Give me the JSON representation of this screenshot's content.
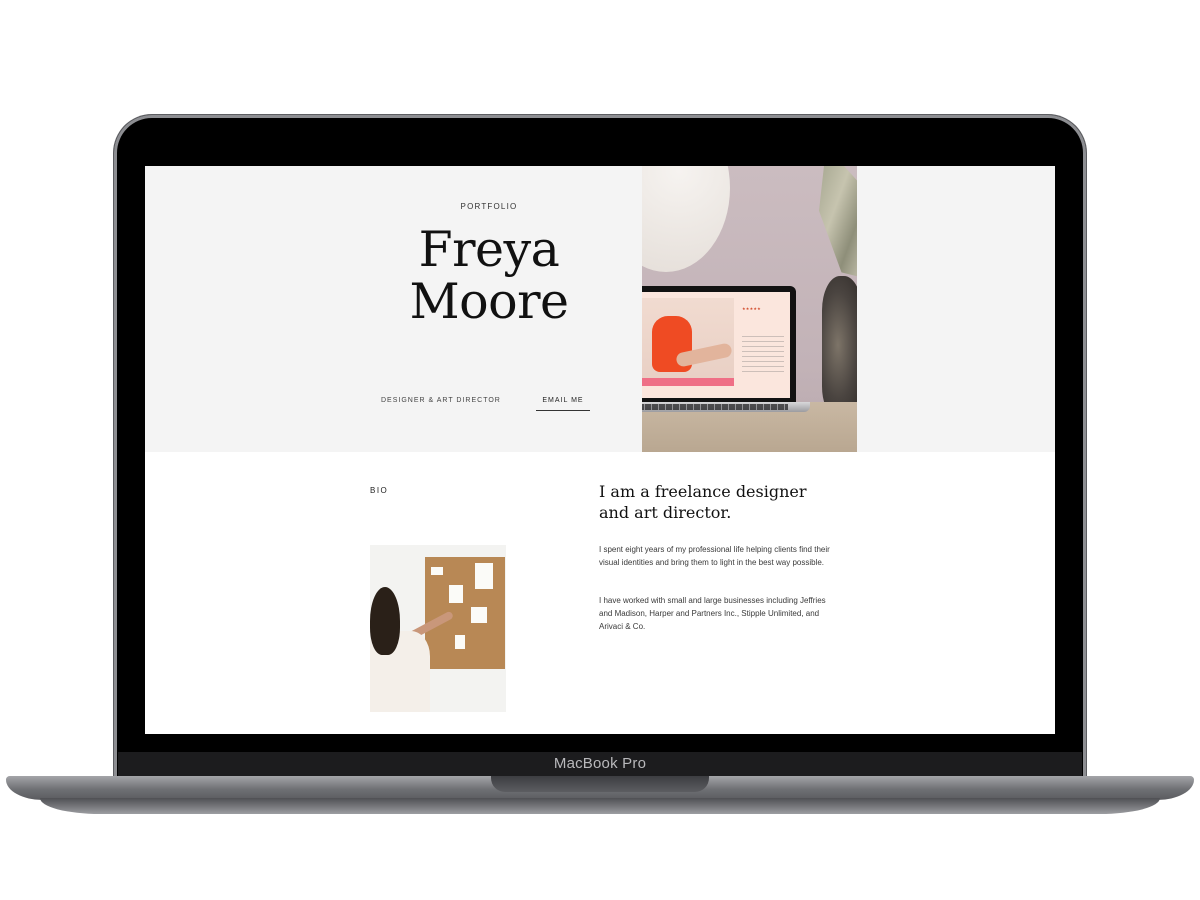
{
  "device": {
    "label": "MacBook Pro"
  },
  "hero": {
    "eyebrow": "PORTFOLIO",
    "name": "Freya Moore",
    "role": "DESIGNER & ART DIRECTOR",
    "email_button": "EMAIL ME"
  },
  "bio": {
    "label": "BIO",
    "headline": "I am a freelance designer and art director.",
    "paragraphs": [
      "I spent eight years of my professional life helping clients find their visual identities and bring them to light in the best way possible.",
      "I have worked with small and large businesses including Jeffries and Madison, Harper and Partners Inc., Stipple Unlimited, and Arivaci & Co."
    ]
  },
  "colors": {
    "hero_background": "#f4f4f4",
    "laptop_body": "#000000",
    "accent_orange": "#ef4b23"
  },
  "icons": [
    "laptop-mockup",
    "star-rating"
  ]
}
